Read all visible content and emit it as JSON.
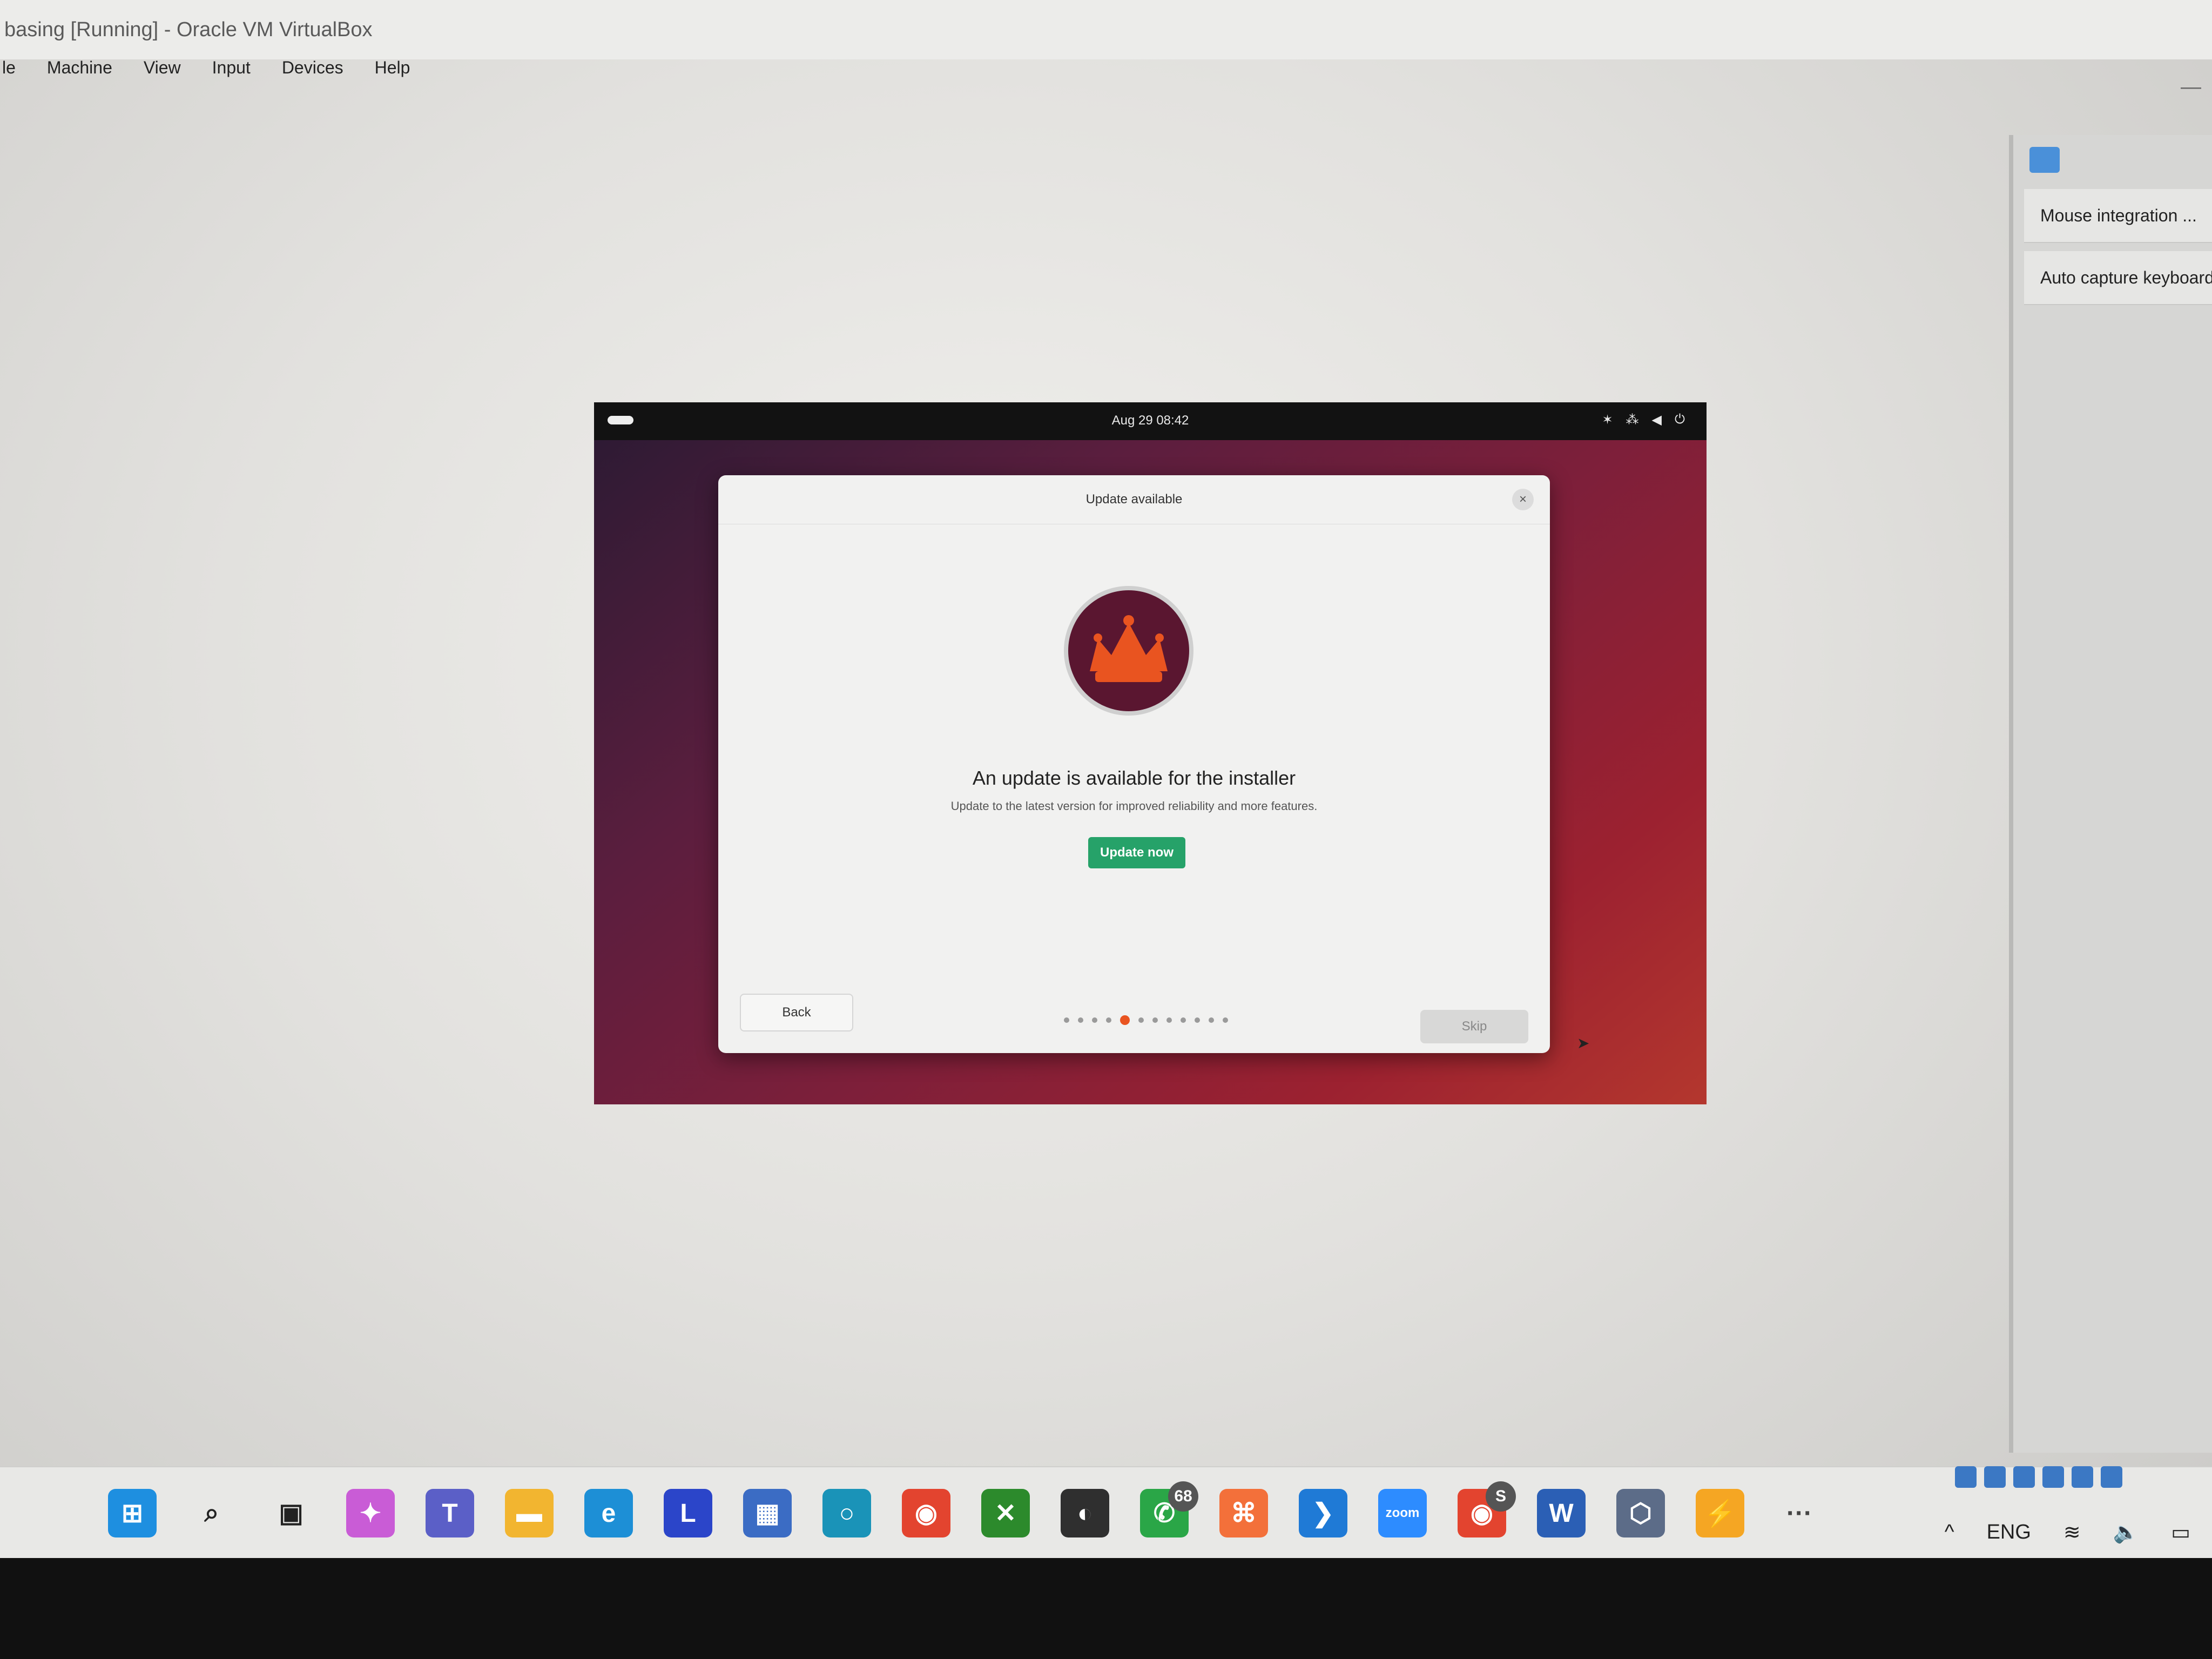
{
  "window": {
    "title": "basing [Running] - Oracle VM VirtualBox",
    "minimize_glyph": "—"
  },
  "menu": {
    "items": [
      "le",
      "Machine",
      "View",
      "Input",
      "Devices",
      "Help"
    ]
  },
  "side_panel": {
    "icon": "chat-bubble-icon",
    "items": [
      "Mouse integration ...",
      "Auto capture keyboard"
    ]
  },
  "vm": {
    "clock": "Aug 29  08:42",
    "tray_icons": [
      "accessibility-icon",
      "network-icon",
      "volume-icon",
      "power-icon"
    ],
    "tray_glyphs": [
      "✶",
      "⁂",
      "◀",
      "⏻"
    ],
    "dialog": {
      "title": "Update available",
      "close_glyph": "×",
      "logo_icon": "crown-icon",
      "headline": "An update is available for the installer",
      "subline": "Update to the latest version for improved reliability and more features.",
      "update_button": "Update now",
      "back_button": "Back",
      "skip_button": "Skip",
      "progress": {
        "total_steps": 12,
        "current_step": 5
      },
      "accent_color": "#e95420",
      "button_color": "#26a269"
    }
  },
  "taskbar": {
    "apps": [
      {
        "name": "start-icon",
        "glyph": "⊞",
        "color": "#1e8fe0"
      },
      {
        "name": "search-icon",
        "glyph": "⌕",
        "color": "#222222"
      },
      {
        "name": "task-view-icon",
        "glyph": "▣",
        "color": "#222222"
      },
      {
        "name": "copilot-icon",
        "glyph": "✦",
        "color": "#c95cd6"
      },
      {
        "name": "teams-icon",
        "glyph": "T",
        "color": "#5b5fc7"
      },
      {
        "name": "file-explorer-icon",
        "glyph": "▬",
        "color": "#f2b530"
      },
      {
        "name": "edge-icon",
        "glyph": "e",
        "color": "#1d8fd6"
      },
      {
        "name": "l-app-icon",
        "glyph": "L",
        "color": "#2b45c9"
      },
      {
        "name": "store-icon",
        "glyph": "▦",
        "color": "#3b6cc4"
      },
      {
        "name": "cortana-icon",
        "glyph": "○",
        "color": "#1a93b8"
      },
      {
        "name": "chrome-icon",
        "glyph": "◉",
        "color": "#e3442f"
      },
      {
        "name": "xbox-icon",
        "glyph": "✕",
        "color": "#2c8a2c"
      },
      {
        "name": "obs-icon",
        "glyph": "◐",
        "color": "#2f2f2f"
      },
      {
        "name": "whatsapp-icon",
        "glyph": "✆",
        "color": "#2aa647",
        "badge": "68"
      },
      {
        "name": "xampp-icon",
        "glyph": "⌘",
        "color": "#f3703a"
      },
      {
        "name": "vscode-icon",
        "glyph": "❯",
        "color": "#1f7ad6"
      },
      {
        "name": "zoom-icon",
        "glyph": "zoom",
        "color": "#2d8cff"
      },
      {
        "name": "chrome-profile-icon",
        "glyph": "◉",
        "color": "#e3442f",
        "badge": "S"
      },
      {
        "name": "word-icon",
        "glyph": "W",
        "color": "#2b5fb5"
      },
      {
        "name": "virtualbox-icon",
        "glyph": "⬡",
        "color": "#5c6c88"
      },
      {
        "name": "sublime-icon",
        "glyph": "⚡",
        "color": "#f5a623"
      },
      {
        "name": "more-icon",
        "glyph": "···",
        "color": "#444444"
      }
    ],
    "tray": {
      "chevron": "^",
      "language": "ENG",
      "wifi": "wifi-icon",
      "volume": "volume-icon",
      "battery": "battery-icon",
      "glyphs": [
        "≋",
        "🔈",
        "▭"
      ]
    }
  }
}
